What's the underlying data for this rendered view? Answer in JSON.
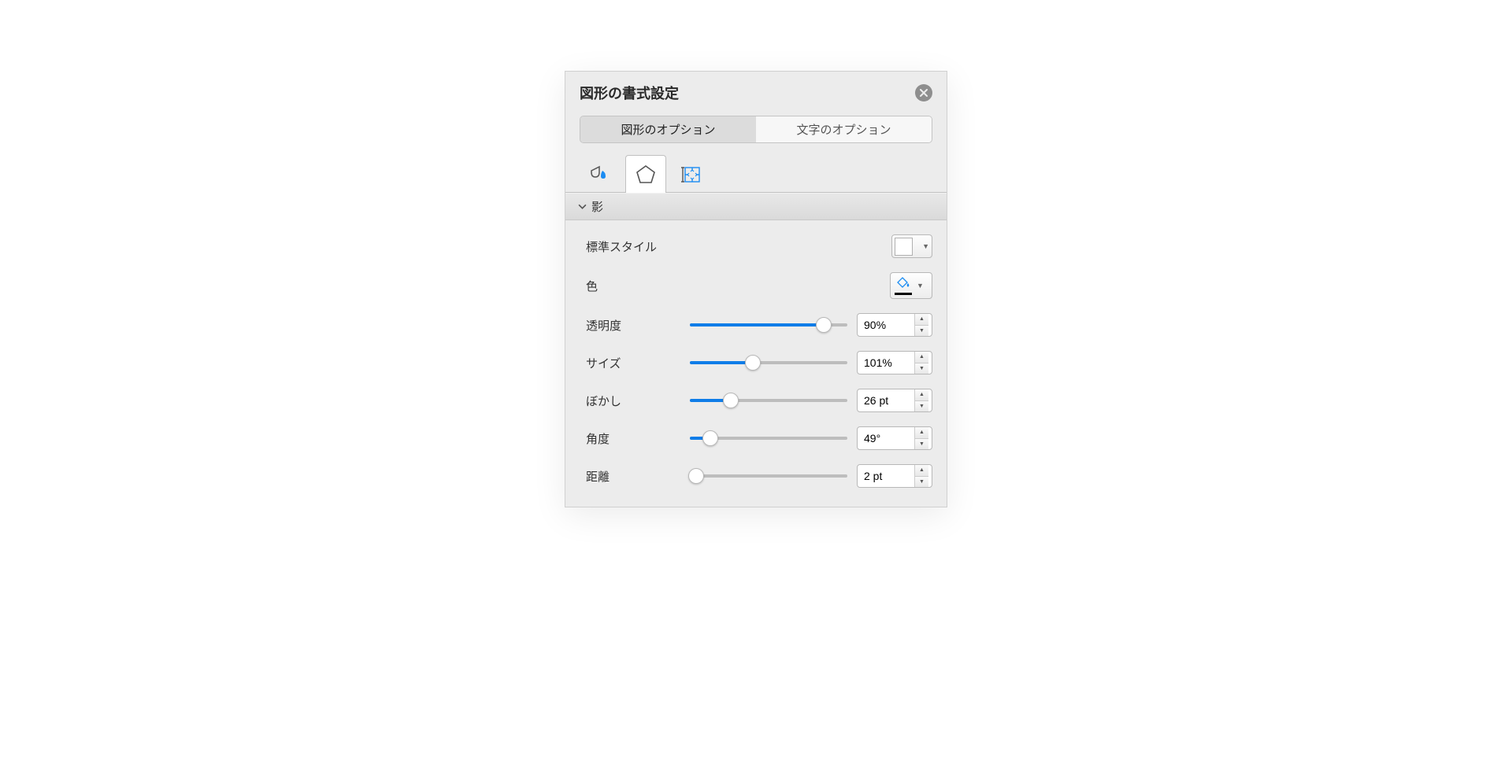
{
  "panel": {
    "title": "図形の書式設定"
  },
  "tabs": {
    "shape_options": "図形のオプション",
    "text_options": "文字のオプション"
  },
  "section": {
    "shadow": "影"
  },
  "rows": {
    "preset_style": {
      "label": "標準スタイル"
    },
    "color": {
      "label": "色"
    },
    "transparency": {
      "label": "透明度",
      "value": "90%",
      "percent": 85
    },
    "size": {
      "label": "サイズ",
      "value": "101%",
      "percent": 40
    },
    "blur": {
      "label": "ぼかし",
      "value": "26 pt",
      "percent": 26
    },
    "angle": {
      "label": "角度",
      "value": "49°",
      "percent": 13
    },
    "distance": {
      "label": "距離",
      "value": "2 pt",
      "percent": 4
    }
  }
}
